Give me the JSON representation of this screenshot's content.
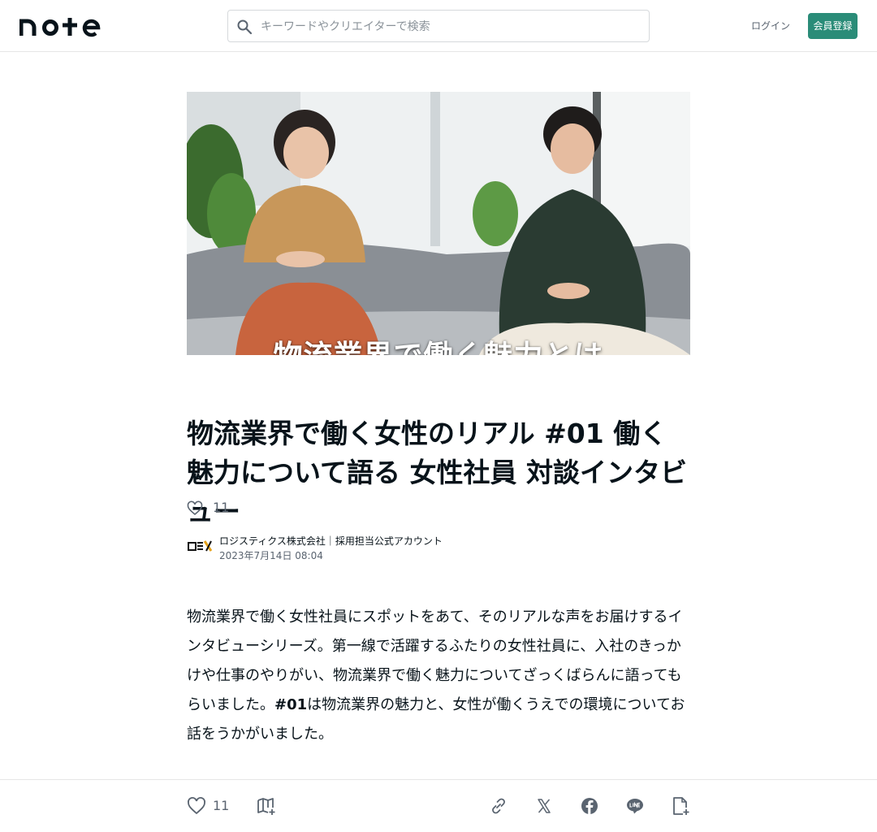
{
  "header": {
    "logo_text": "note",
    "search_placeholder": "キーワードやクリエイターで検索",
    "login_label": "ログイン",
    "signup_label": "会員登録"
  },
  "hero": {
    "caption": "物流業界で働く魅力とは"
  },
  "article": {
    "title": "物流業界で働く女性のリアル #01 働く魅力について語る 女性社員 対談インタビュー",
    "likes": "11",
    "author_name": "ロジスティクス株式会社｜採用担当公式アカウント",
    "date": "2023年7月14日 08:04",
    "body_part1": "物流業界で働く女性社員にスポットをあて、そのリアルな声をお届けするインタビューシリーズ。第一線で活躍するふたりの女性社員に、入社のきっかけや仕事のやりがい、物流業界で働く魅力についてざっくばらんに語ってもらいました。",
    "body_bold": "#01",
    "body_part2": "は物流業界の魅力と、女性が働くうえでの環境についてお話をうかがいました。"
  },
  "toolbar": {
    "like_count": "11"
  },
  "colors": {
    "brand_green": "#2a8c78",
    "text": "#08131a",
    "muted": "#5a6470"
  },
  "icons": [
    "search-icon",
    "heart-icon",
    "magazine-add-icon",
    "link-icon",
    "x-icon",
    "facebook-icon",
    "line-icon",
    "save-note-icon"
  ]
}
